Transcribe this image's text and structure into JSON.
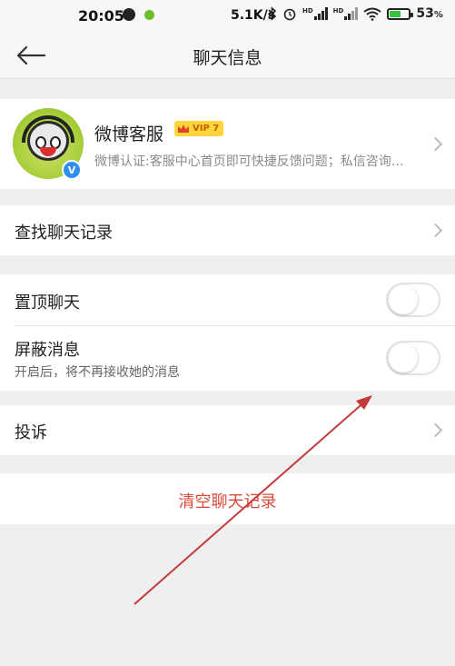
{
  "status_bar": {
    "time": "20:05",
    "net_speed": "5.1K/s",
    "network_badge_left": "HD",
    "network_badge_right": "HD",
    "battery_pct": "53",
    "battery_pct_suffix": "%"
  },
  "nav": {
    "title": "聊天信息"
  },
  "profile": {
    "name": "微博客服",
    "vip_label": "VIP 7",
    "description": "微博认证:客服中心首页即可快捷反馈问题；私信咨询…"
  },
  "rows": {
    "history_label": "查找聊天记录",
    "pin_label": "置顶聊天",
    "mute_label": "屏蔽消息",
    "mute_sub": "开启后，将不再接收她的消息",
    "complain_label": "投诉",
    "clear_label": "清空聊天记录"
  },
  "toggles": {
    "pin_on": false,
    "mute_on": false
  },
  "colors": {
    "background": "#efefef",
    "accent_red": "#d94a3a",
    "verified_blue": "#2f8ef0",
    "vip_gold": "#ffd63a",
    "annotation_arrow": "#c23a3a"
  },
  "icons": {
    "back": "arrow-left-icon",
    "chevron": "chevron-right-icon",
    "verified": "verified-v-icon",
    "vip": "crown-icon"
  }
}
